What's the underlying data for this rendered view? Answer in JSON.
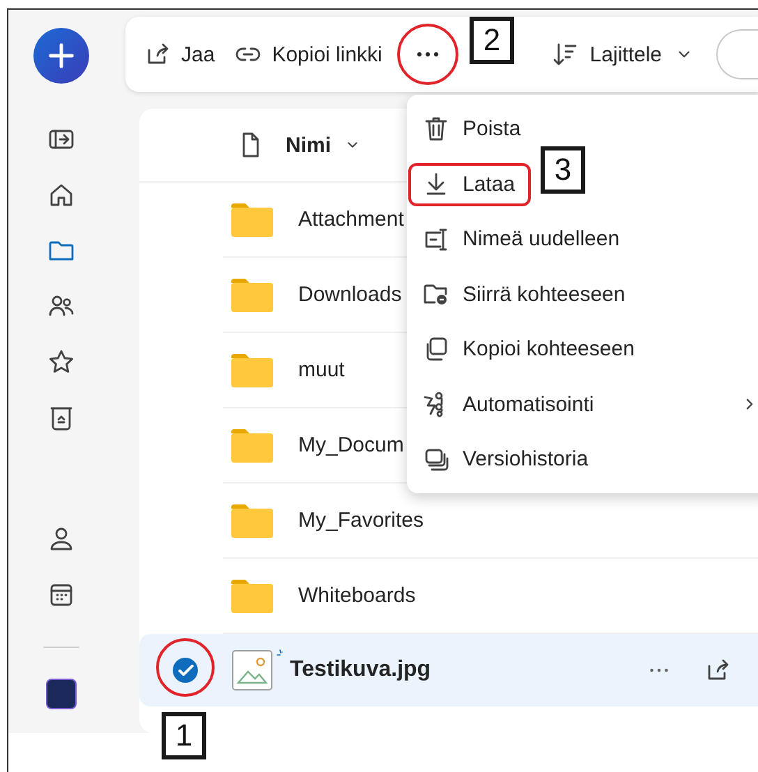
{
  "toolbar": {
    "actions": [
      {
        "label": "Jaa",
        "kind": "share"
      },
      {
        "label": "Kopioi linkki",
        "kind": "link"
      }
    ],
    "more": {
      "highlighted": true,
      "callout": "2"
    },
    "sort": {
      "label": "Lajittele"
    }
  },
  "nav": [
    {
      "kind": "panel",
      "selected": false
    },
    {
      "kind": "home",
      "selected": false
    },
    {
      "kind": "folder",
      "selected": true
    },
    {
      "kind": "people",
      "selected": false
    },
    {
      "kind": "star",
      "selected": false
    },
    {
      "kind": "bin",
      "selected": false
    },
    {
      "kind": "person",
      "selected": false
    },
    {
      "kind": "calendar",
      "selected": false
    }
  ],
  "list": {
    "header": "Nimi",
    "rows": [
      {
        "name": "Attachment",
        "kind": "folder",
        "selected": false
      },
      {
        "name": "Downloads",
        "kind": "folder",
        "selected": false
      },
      {
        "name": "muut",
        "kind": "folder",
        "selected": false
      },
      {
        "name": "My_Docum",
        "kind": "folder",
        "selected": false
      },
      {
        "name": "My_Favorites",
        "kind": "folder",
        "selected": false
      },
      {
        "name": "Whiteboards",
        "kind": "folder",
        "selected": false
      },
      {
        "name": "Testikuva.jpg",
        "kind": "image",
        "selected": true,
        "new": true,
        "highlighted": true,
        "callout": "1"
      }
    ]
  },
  "menu": [
    {
      "label": "Poista",
      "kind": "trash",
      "highlighted": false,
      "submenu": false
    },
    {
      "label": "Lataa",
      "kind": "download",
      "highlighted": true,
      "callout": "3",
      "submenu": false
    },
    {
      "label": "Nimeä uudelleen",
      "kind": "rename",
      "highlighted": false,
      "submenu": false
    },
    {
      "label": "Siirrä kohteeseen",
      "kind": "move",
      "highlighted": false,
      "submenu": false
    },
    {
      "label": "Kopioi kohteeseen",
      "kind": "copy",
      "highlighted": false,
      "submenu": false
    },
    {
      "label": "Automatisointi",
      "kind": "flow",
      "highlighted": false,
      "submenu": true
    },
    {
      "label": "Versiohistoria",
      "kind": "versions",
      "highlighted": false,
      "submenu": false
    }
  ]
}
